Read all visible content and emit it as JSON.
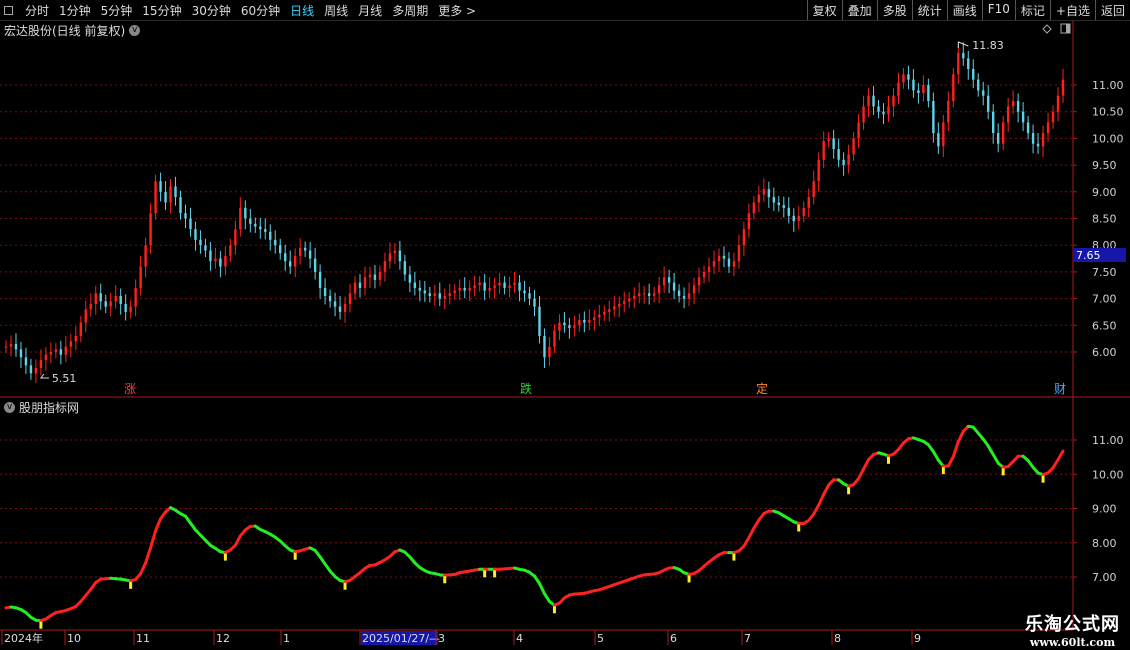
{
  "toolbar": {
    "left_items": [
      "分时",
      "1分钟",
      "5分钟",
      "15分钟",
      "30分钟",
      "60分钟",
      "日线",
      "周线",
      "月线",
      "多周期",
      "更多 >"
    ],
    "active": "日线",
    "right_items": [
      "复权",
      "叠加",
      "多股",
      "统计",
      "画线",
      "F10",
      "标记",
      "+自选",
      "返回"
    ]
  },
  "main_panel": {
    "title": "宏达股份(日线 前复权)",
    "high_label": "11.83",
    "low_label": "5.51",
    "current_price_tag": "7.65",
    "y_ticks": [
      "6.00",
      "6.50",
      "7.00",
      "7.50",
      "8.00",
      "8.50",
      "9.00",
      "9.50",
      "10.00",
      "10.50",
      "11.00"
    ],
    "markers": [
      {
        "text": "涨",
        "color": "#ff3b3b"
      },
      {
        "text": "跌",
        "color": "#2fd62f"
      },
      {
        "text": "定",
        "color": "#ff8a2a"
      },
      {
        "text": "财",
        "color": "#4aa8ff"
      }
    ]
  },
  "sub_panel": {
    "title": "股朋指标网",
    "y_ticks": [
      "7.00",
      "8.00",
      "9.00",
      "10.00",
      "11.00"
    ]
  },
  "x_axis": {
    "labels": [
      "2024年",
      "10",
      "11",
      "12",
      "1",
      "2025/01/27/—",
      "3",
      "4",
      "5",
      "6",
      "7",
      "8",
      "9"
    ],
    "highlight": "2025/01/27/—"
  },
  "watermark": {
    "line1": "乐淘公式网",
    "line2": "www.60lt.com"
  },
  "colors": {
    "up": "#ff2020",
    "down": "#5fd3e8",
    "ma_up": "#ff2020",
    "ma_down": "#22ee22",
    "grid": "#7a1010",
    "axis": "#b01818"
  },
  "chart_data": {
    "type": "candlestick",
    "close": [
      6.1,
      6.15,
      6.05,
      5.9,
      5.75,
      5.6,
      5.7,
      5.85,
      5.95,
      6.0,
      6.05,
      5.95,
      6.1,
      6.2,
      6.3,
      6.55,
      6.8,
      6.9,
      7.1,
      6.95,
      6.85,
      6.95,
      7.05,
      6.9,
      6.75,
      6.85,
      7.2,
      7.6,
      8.0,
      8.6,
      9.2,
      9.0,
      8.8,
      9.1,
      8.9,
      8.6,
      8.5,
      8.3,
      8.1,
      8.0,
      7.9,
      7.7,
      7.75,
      7.6,
      7.8,
      8.0,
      8.3,
      8.7,
      8.5,
      8.4,
      8.35,
      8.3,
      8.25,
      8.1,
      8.0,
      7.85,
      7.7,
      7.6,
      7.8,
      7.95,
      7.9,
      7.75,
      7.5,
      7.2,
      7.05,
      6.95,
      6.85,
      6.75,
      6.9,
      7.1,
      7.3,
      7.2,
      7.4,
      7.45,
      7.35,
      7.5,
      7.7,
      7.85,
      7.9,
      7.7,
      7.45,
      7.3,
      7.2,
      7.15,
      7.1,
      7.05,
      7.1,
      7.0,
      7.05,
      7.1,
      7.15,
      7.2,
      7.15,
      7.2,
      7.25,
      7.3,
      7.15,
      7.2,
      7.25,
      7.3,
      7.2,
      7.25,
      7.3,
      7.15,
      7.1,
      7.0,
      6.85,
      6.3,
      5.9,
      6.1,
      6.4,
      6.55,
      6.5,
      6.45,
      6.5,
      6.6,
      6.55,
      6.6,
      6.65,
      6.7,
      6.75,
      6.8,
      6.85,
      6.9,
      6.95,
      7.0,
      7.05,
      7.1,
      7.1,
      7.05,
      7.1,
      7.25,
      7.4,
      7.3,
      7.15,
      7.05,
      7.0,
      7.1,
      7.25,
      7.4,
      7.5,
      7.6,
      7.7,
      7.8,
      7.75,
      7.6,
      7.7,
      8.0,
      8.3,
      8.6,
      8.8,
      8.95,
      9.05,
      8.9,
      8.8,
      8.75,
      8.7,
      8.55,
      8.45,
      8.55,
      8.7,
      8.9,
      9.2,
      9.6,
      9.95,
      10.0,
      9.8,
      9.6,
      9.5,
      9.7,
      10.0,
      10.3,
      10.6,
      10.8,
      10.6,
      10.5,
      10.45,
      10.6,
      10.8,
      11.05,
      11.2,
      11.1,
      10.9,
      10.85,
      11.0,
      10.7,
      10.1,
      9.85,
      10.3,
      10.7,
      11.2,
      11.6,
      11.5,
      11.3,
      11.1,
      10.9,
      10.8,
      10.5,
      10.1,
      9.9,
      10.3,
      10.6,
      10.7,
      10.5,
      10.3,
      10.1,
      9.9,
      9.85,
      10.1,
      10.3,
      10.5,
      10.8,
      11.1
    ]
  }
}
